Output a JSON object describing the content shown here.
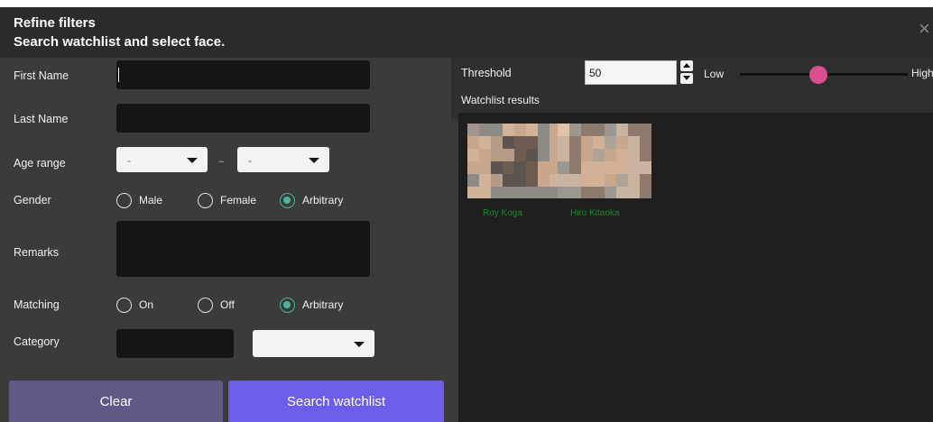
{
  "header": {
    "title_line1": "Refine filters",
    "title_line2": "Search watchlist and select face.",
    "close_glyph": "×"
  },
  "form": {
    "first_name": {
      "label": "First Name",
      "value": ""
    },
    "last_name": {
      "label": "Last Name",
      "value": ""
    },
    "age_range": {
      "label": "Age range",
      "from_value": "-",
      "separator": "~",
      "to_value": "-"
    },
    "gender": {
      "label": "Gender",
      "options": [
        "Male",
        "Female",
        "Arbitrary"
      ],
      "selected": "Arbitrary"
    },
    "remarks": {
      "label": "Remarks",
      "value": ""
    },
    "matching": {
      "label": "Matching",
      "options": [
        "On",
        "Off",
        "Arbitrary"
      ],
      "selected": "Arbitrary"
    },
    "category": {
      "label": "Category",
      "value": "",
      "select_value": ""
    }
  },
  "buttons": {
    "clear": "Clear",
    "search": "Search watchlist"
  },
  "threshold": {
    "label": "Threshold",
    "value": "50",
    "low_label": "Low",
    "high_label": "High",
    "slider_fraction": 0.47
  },
  "results": {
    "label": "Watchlist results",
    "faces": [
      {
        "name": "Roy Koga"
      },
      {
        "name": "Hiro Kitaoka"
      }
    ]
  },
  "colors": {
    "accent_purple": "#6c5ee8",
    "clear_button": "#5f5a85",
    "radio_selected": "#4ab39a",
    "slider_thumb": "#d94f8f",
    "face_name": "#1a8a2a"
  }
}
